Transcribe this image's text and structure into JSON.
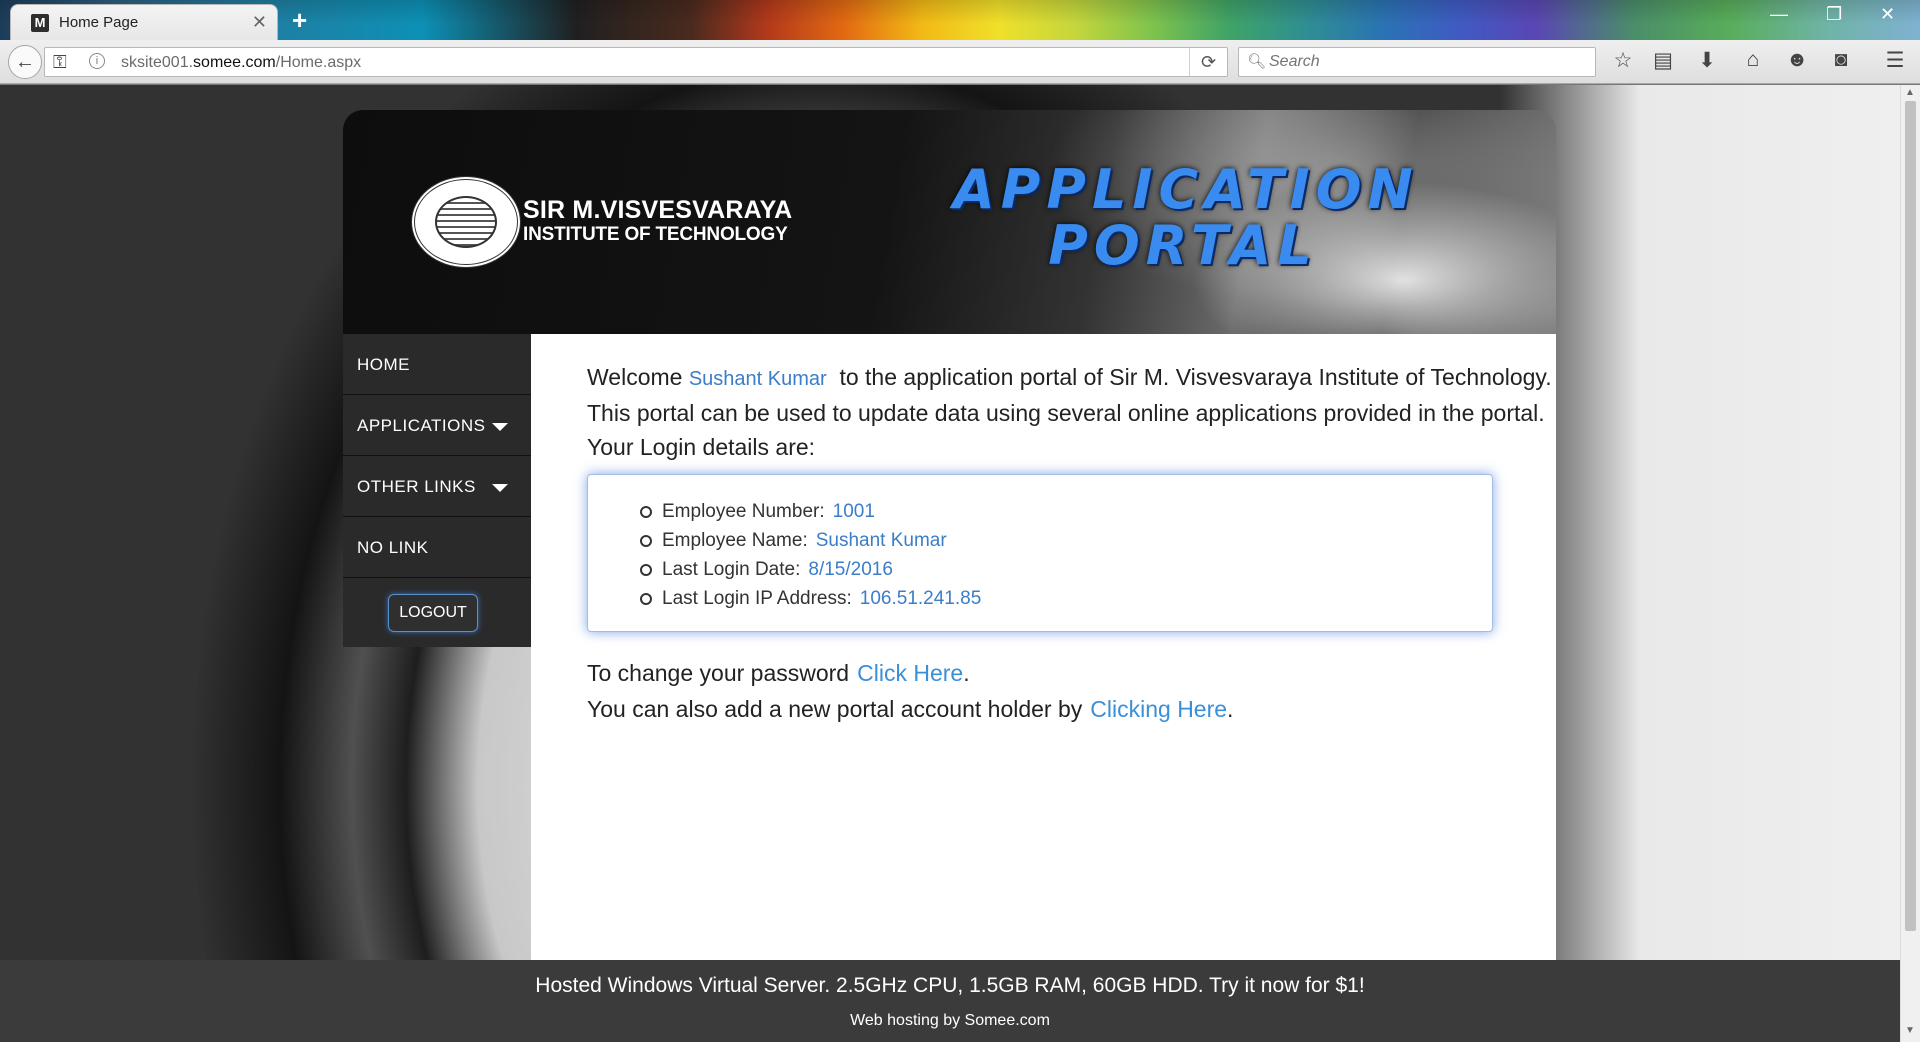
{
  "browser": {
    "tab_title": "Home Page",
    "tab_favicon_letter": "M",
    "new_tab_symbol": "+",
    "url_prefix": "sksite001.",
    "url_domain": "somee.com",
    "url_path": "/Home.aspx",
    "search_placeholder": "Search",
    "icons": [
      "back-arrow-icon",
      "key-icon",
      "info-icon",
      "reload-icon",
      "search-icon",
      "star-icon",
      "reading-list-icon",
      "download-icon",
      "home-icon",
      "smiley-icon",
      "pocket-icon",
      "hamburger-menu-icon",
      "minimize-icon",
      "restore-icon",
      "close-icon"
    ]
  },
  "header": {
    "institute_line1": "SIR M.VISVESVARAYA",
    "institute_line2": "INSTITUTE OF TECHNOLOGY",
    "title_line1": "APPLICATION",
    "title_line2": "PORTAL"
  },
  "sidebar": {
    "items": [
      {
        "label": "HOME",
        "has_dropdown": false
      },
      {
        "label": "APPLICATIONS",
        "has_dropdown": true
      },
      {
        "label": "OTHER LINKS",
        "has_dropdown": true
      },
      {
        "label": "NO LINK",
        "has_dropdown": false
      }
    ],
    "logout_label": "LOGOUT"
  },
  "content": {
    "welcome_prefix": "Welcome",
    "user_name": "Sushant Kumar",
    "welcome_suffix": "to the application portal of Sir M. Visvesvaraya Institute of Technology.",
    "line2": "This portal can be used to update data using several online applications provided in the portal.",
    "line3": "Your Login details are:",
    "details": [
      {
        "label": "Employee Number:",
        "value": "1001"
      },
      {
        "label": "Employee Name:",
        "value": "Sushant Kumar"
      },
      {
        "label": "Last Login Date:",
        "value": "8/15/2016"
      },
      {
        "label": "Last Login IP Address:",
        "value": "106.51.241.85"
      }
    ],
    "change_pw_text": "To change your password",
    "change_pw_link": "Click Here",
    "add_account_text": "You can also add a new portal account holder by",
    "add_account_link": "Clicking Here",
    "period": "."
  },
  "footer": {
    "ad_text": "Hosted Windows Virtual Server. 2.5GHz CPU, 1.5GB RAM, 60GB HDD. Try it now for $1!",
    "hosting_text": "Web hosting by Somee.com"
  },
  "colors": {
    "link_blue": "#3a8fd9",
    "title_blue": "#3a8bf0",
    "sidebar_bg": "#2a2a2a",
    "footer_bg": "#3b3b3b"
  }
}
